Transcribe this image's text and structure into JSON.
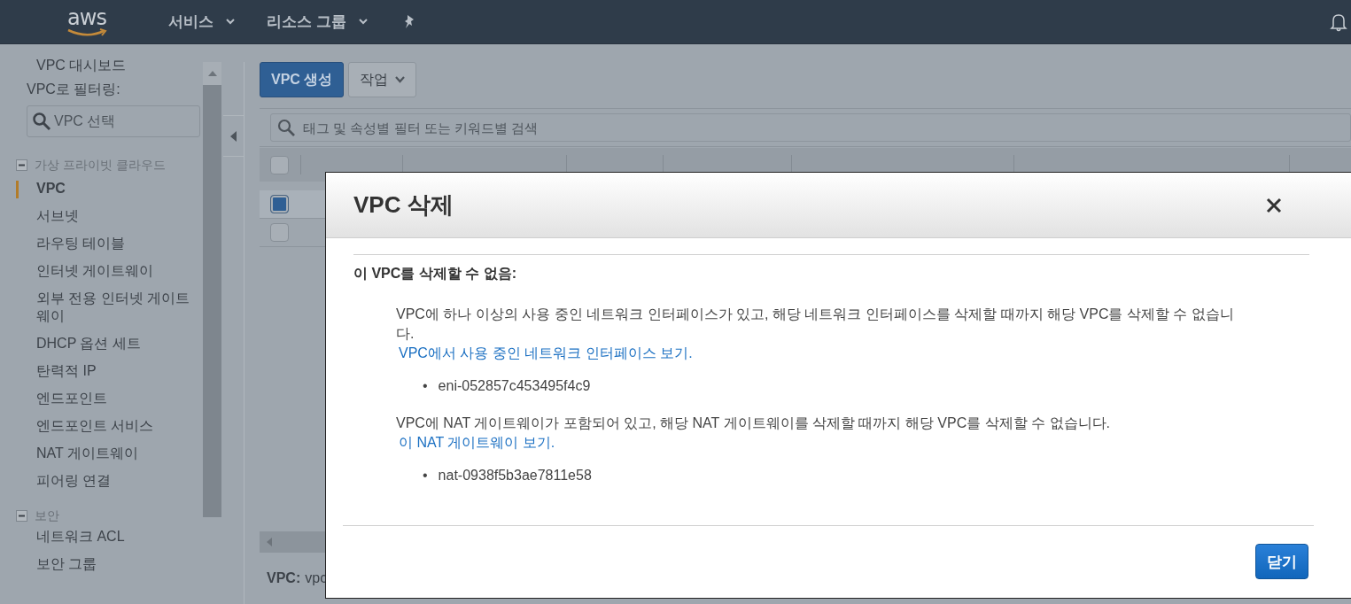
{
  "topbar": {
    "logo": "aws",
    "menus": [
      {
        "label": "서비스"
      },
      {
        "label": "리소스 그룹"
      }
    ]
  },
  "sidebar": {
    "dashboard": "VPC 대시보드",
    "filter_label": "VPC로 필터링:",
    "filter_placeholder": "VPC 선택",
    "sections": [
      {
        "title": "가상 프라이빗 클라우드",
        "expanded": true,
        "items": [
          {
            "label": "VPC",
            "selected": true
          },
          {
            "label": "서브넷",
            "selected": false
          },
          {
            "label": "라우팅 테이블",
            "selected": false
          },
          {
            "label": "인터넷 게이트웨이",
            "selected": false
          },
          {
            "label": "외부 전용 인터넷 게이트웨이",
            "selected": false
          },
          {
            "label": "DHCP 옵션 세트",
            "selected": false
          },
          {
            "label": "탄력적 IP",
            "selected": false
          },
          {
            "label": "엔드포인트",
            "selected": false
          },
          {
            "label": "엔드포인트 서비스",
            "selected": false
          },
          {
            "label": "NAT 게이트웨이",
            "selected": false
          },
          {
            "label": "피어링 연결",
            "selected": false
          }
        ]
      },
      {
        "title": "보안",
        "expanded": true,
        "items": [
          {
            "label": "네트워크 ACL",
            "selected": false
          },
          {
            "label": "보안 그룹",
            "selected": false
          }
        ]
      }
    ]
  },
  "toolbar": {
    "buttons": [
      {
        "label": "VPC 생성",
        "kind": "primary"
      },
      {
        "label": "작업",
        "kind": "dropdown"
      }
    ]
  },
  "search": {
    "placeholder": "태그 및 속성별 필터 또는 키워드별 검색"
  },
  "table": {
    "all_checked": false,
    "rows": [
      {
        "selected": true
      },
      {
        "selected": false
      }
    ]
  },
  "details": {
    "label": "VPC:",
    "value": "vpc"
  },
  "dialog": {
    "title": "VPC 삭제",
    "bullet_marker": "•",
    "heading": "이 VPC를 삭제할 수 없음:",
    "blocks": [
      {
        "text": "VPC에 하나 이상의 사용 중인 네트워크 인터페이스가 있고, 해당 네트워크 인터페이스를 삭제할 때까지 해당 VPC를 삭제할 수 없습니다.",
        "link": "VPC에서 사용 중인 네트워크 인터페이스 보기.",
        "bullets": [
          "eni-052857c453495f4c9"
        ]
      },
      {
        "text": "VPC에 NAT 게이트웨이가 포함되어 있고, 해당 NAT 게이트웨이를 삭제할 때까지 해당 VPC를 삭제할 수 없습니다.",
        "link": "이 NAT 게이트웨이 보기.",
        "bullets": [
          "nat-0938f5b3ae7811e58"
        ]
      }
    ],
    "close_button": "닫기"
  }
}
